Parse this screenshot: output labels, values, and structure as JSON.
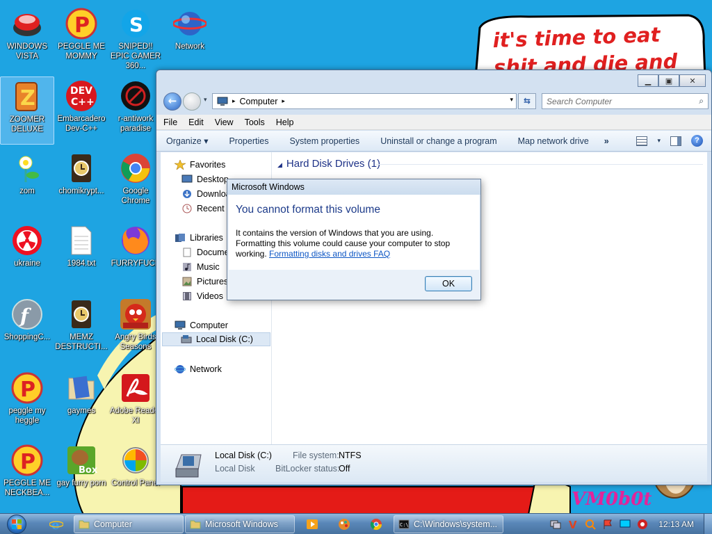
{
  "desktop": {
    "wallpaper_text": "it's time to eat shit and die and chew",
    "signature": "VM0b0t",
    "icons": [
      {
        "label": "WINDOWS VISTA",
        "icon": "vista-logo-icon"
      },
      {
        "label": "PEGGLE ME MOMMY",
        "icon": "peggle-icon"
      },
      {
        "label": "SNIPED!! EPIC GAMER 360...",
        "icon": "skype-icon"
      },
      {
        "label": "Network",
        "icon": "network-globe-icon"
      },
      {
        "label": "ZOOMER DELUXE",
        "icon": "zoomer-icon"
      },
      {
        "label": "Embarcadero Dev-C++",
        "icon": "devcpp-icon"
      },
      {
        "label": "r-antiwork paradise",
        "icon": "antiwork-icon"
      },
      {
        "label": "zom",
        "icon": "plant-icon"
      },
      {
        "label": "chomikrypt...",
        "icon": "installer-icon"
      },
      {
        "label": "Google Chrome",
        "icon": "chrome-icon"
      },
      {
        "label": "ukraine",
        "icon": "radiation-icon"
      },
      {
        "label": "1984.txt",
        "icon": "text-file-icon"
      },
      {
        "label": "FURRYFUCK",
        "icon": "firefox-icon"
      },
      {
        "label": "ShoppingC...",
        "icon": "flash-icon"
      },
      {
        "label": "MEMZ DESTRUCTI...",
        "icon": "installer-icon"
      },
      {
        "label": "Angry Birds Seasons",
        "icon": "angry-birds-icon"
      },
      {
        "label": "peggle my heggle",
        "icon": "peggle-icon"
      },
      {
        "label": "gaymes",
        "icon": "folder-icon"
      },
      {
        "label": "Adobe Reader XI",
        "icon": "adobe-reader-icon"
      },
      {
        "label": "PEGGLE ME NECKBEA...",
        "icon": "peggle-icon"
      },
      {
        "label": "gay furry porn",
        "icon": "box-icon"
      },
      {
        "label": "Control Panel",
        "icon": "control-panel-icon"
      }
    ]
  },
  "explorer": {
    "address": {
      "root_arrow": "▸",
      "crumb": "Computer",
      "crumb_arrow": "▸"
    },
    "search_placeholder": "Search Computer",
    "menu": [
      "File",
      "Edit",
      "View",
      "Tools",
      "Help"
    ],
    "commands": [
      "Organize ▾",
      "Properties",
      "System properties",
      "Uninstall or change a program",
      "Map network drive",
      "»"
    ],
    "nav": {
      "favorites": "Favorites",
      "desktop": "Desktop",
      "downloads": "Downloads",
      "recent": "Recent Places",
      "libraries": "Libraries",
      "documents": "Documents",
      "music": "Music",
      "pictures": "Pictures",
      "videos": "Videos",
      "computer": "Computer",
      "local_disk": "Local Disk (C:)",
      "network": "Network"
    },
    "group_header": "Hard Disk Drives (1)",
    "details": {
      "name": "Local Disk (C:)",
      "type": "Local Disk",
      "fs_label": "File system:",
      "fs_value": "NTFS",
      "bitlocker_label": "BitLocker status:",
      "bitlocker_value": "Off"
    }
  },
  "dialog": {
    "title": "Microsoft Windows",
    "heading": "You cannot format this volume",
    "message": "It contains the version of Windows that you are using. Formatting this volume could cause your computer to stop working.",
    "link": "Formatting disks and drives FAQ",
    "ok": "OK"
  },
  "taskbar": {
    "items": [
      {
        "label": "Computer",
        "icon": "explorer-folder-icon"
      },
      {
        "label": "Microsoft Windows",
        "icon": "explorer-folder-icon"
      },
      {
        "label": "C:\\Windows\\system...",
        "icon": "cmd-icon"
      }
    ],
    "clock": "12:13 AM"
  },
  "colors": {
    "desktop_bg": "#1ea4e2",
    "accent": "#1d3b8a",
    "link": "#0b55c4",
    "wall_text": "#e02020",
    "signature": "#e3249a"
  }
}
